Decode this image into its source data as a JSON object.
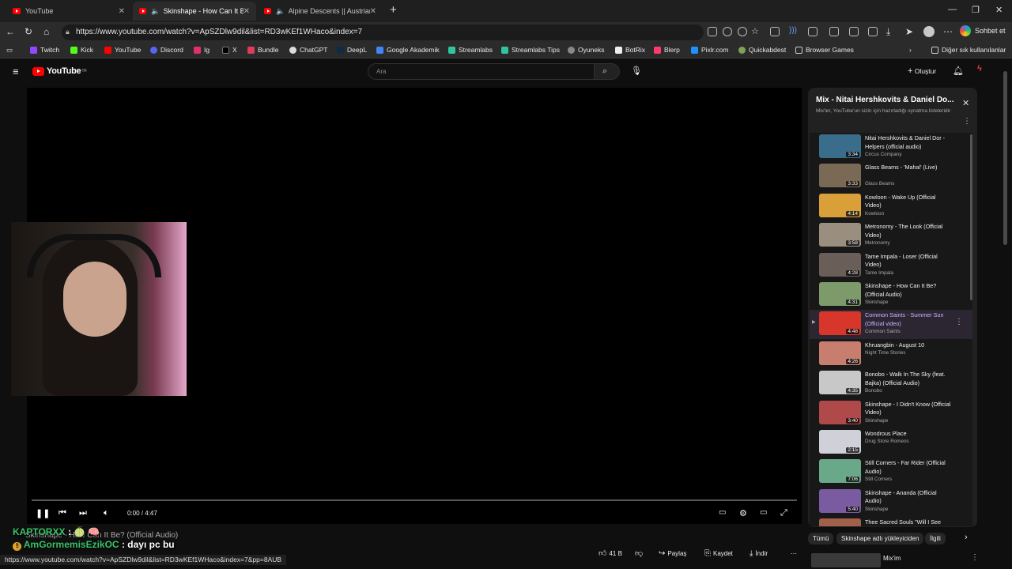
{
  "browser": {
    "tabs": [
      {
        "label": "YouTube"
      },
      {
        "label": "Skinshape - How Can It Be? (O"
      },
      {
        "label": "Alpine Descents || Austrian Al"
      }
    ],
    "url": "https://www.youtube.com/watch?v=ApSZDlw9dil&list=RD3wKEf1WHaco&index=7",
    "copilot_label": "Sohbet et",
    "bookmarks": [
      "Twitch",
      "Kick",
      "YouTube",
      "Discord",
      "Ig",
      "X",
      "Bundle",
      "ChatGPT",
      "DeepL",
      "Google Akademik",
      "Streamlabs",
      "Streamlabs Tips",
      "Oyuneks",
      "BotRix",
      "Blerp",
      "Pixlr.com",
      "Quickabdest",
      "Browser Games"
    ],
    "bookmarks_more": "Diğer sık kullanılanlar",
    "status_url": "https://www.youtube.com/watch?v=ApSZDlw9dil&list=RD3wKEf1WHaco&index=7&pp=8AUB"
  },
  "youtube": {
    "logo": "YouTube",
    "logo_region": "TR",
    "search_placeholder": "Ara",
    "create_label": "Oluştur",
    "player": {
      "time": "0:00 / 4:47",
      "video_title": "Skinshape - How Can It Be? (Official Audio)"
    },
    "chat": [
      {
        "user": "KAPTORXX",
        "text": ": 🍈 🧠"
      },
      {
        "user": "AmGormemisEzikOC",
        "text": ": dayı pc bu"
      }
    ],
    "actions": {
      "likes": "41 B",
      "share": "Paylaş",
      "save": "Kaydet",
      "download": "İndir"
    },
    "playlist": {
      "title": "Mix - Nitai Hershkovits & Daniel Do...",
      "subtitle": "Mix'ler, YouTube'un sizin için hazırladığı oynatma listeleridir",
      "items": [
        {
          "title": "Nitai Hershkovits & Daniel Dor - Helpers (official audio)",
          "author": "Circus Company",
          "duration": "3:34",
          "color": "#3a6c8c"
        },
        {
          "title": "Glass Beams - 'Mahal' (Live)",
          "author": "Glass Beams",
          "duration": "3:33",
          "color": "#7a6a55"
        },
        {
          "title": "Kowloon - Wake Up (Official Video)",
          "author": "Kowloon",
          "duration": "4:14",
          "color": "#d9a03a"
        },
        {
          "title": "Metronomy - The Look (Official Video)",
          "author": "Metronomy",
          "duration": "3:58",
          "color": "#9a8f7f"
        },
        {
          "title": "Tame Impala - Loser (Official Video)",
          "author": "Tame Impala",
          "duration": "4:28",
          "color": "#6a5e58"
        },
        {
          "title": "Skinshape - How Can It Be? (Official Audio)",
          "author": "Skinshape",
          "duration": "4:31",
          "color": "#7d9a6a"
        },
        {
          "title": "Common Saints - Summer Sun (Official video)",
          "author": "Common Saints",
          "duration": "4:48",
          "color": "#d8362a"
        },
        {
          "title": "Khruangbin - August 10",
          "author": "Night Time Stories",
          "duration": "4:26",
          "color": "#c77e6e"
        },
        {
          "title": "Bonobo - Walk In The Sky (feat. Bajka) (Official Audio)",
          "author": "Bonobo",
          "duration": "4:35",
          "color": "#c8c8c8"
        },
        {
          "title": "Skinshape - I Didn't Know (Official Video)",
          "author": "Skinshape",
          "duration": "3:40",
          "color": "#b04a4a"
        },
        {
          "title": "Wondrous Place",
          "author": "Drug Store Romeos",
          "duration": "2:15",
          "color": "#d0d0d8"
        },
        {
          "title": "Still Corners - Far Rider (Official Audio)",
          "author": "Still Corners",
          "duration": "7:06",
          "color": "#6aa88a"
        },
        {
          "title": "Skinshape - Ananda (Official Audio)",
          "author": "Skinshape",
          "duration": "5:40",
          "color": "#7a5aa0"
        },
        {
          "title": "Thee Sacred Souls \"Will I See You Again?\"",
          "author": "",
          "duration": "",
          "color": "#a0604a"
        }
      ]
    },
    "chips": [
      "Tümü",
      "Skinshape adlı yükleyiciden",
      "İlgili"
    ],
    "next_item": "Mix'im"
  },
  "colors": {
    "accent": "#ff0000",
    "bg": "#0f0f0f",
    "active_item": "#c8b4ff"
  }
}
